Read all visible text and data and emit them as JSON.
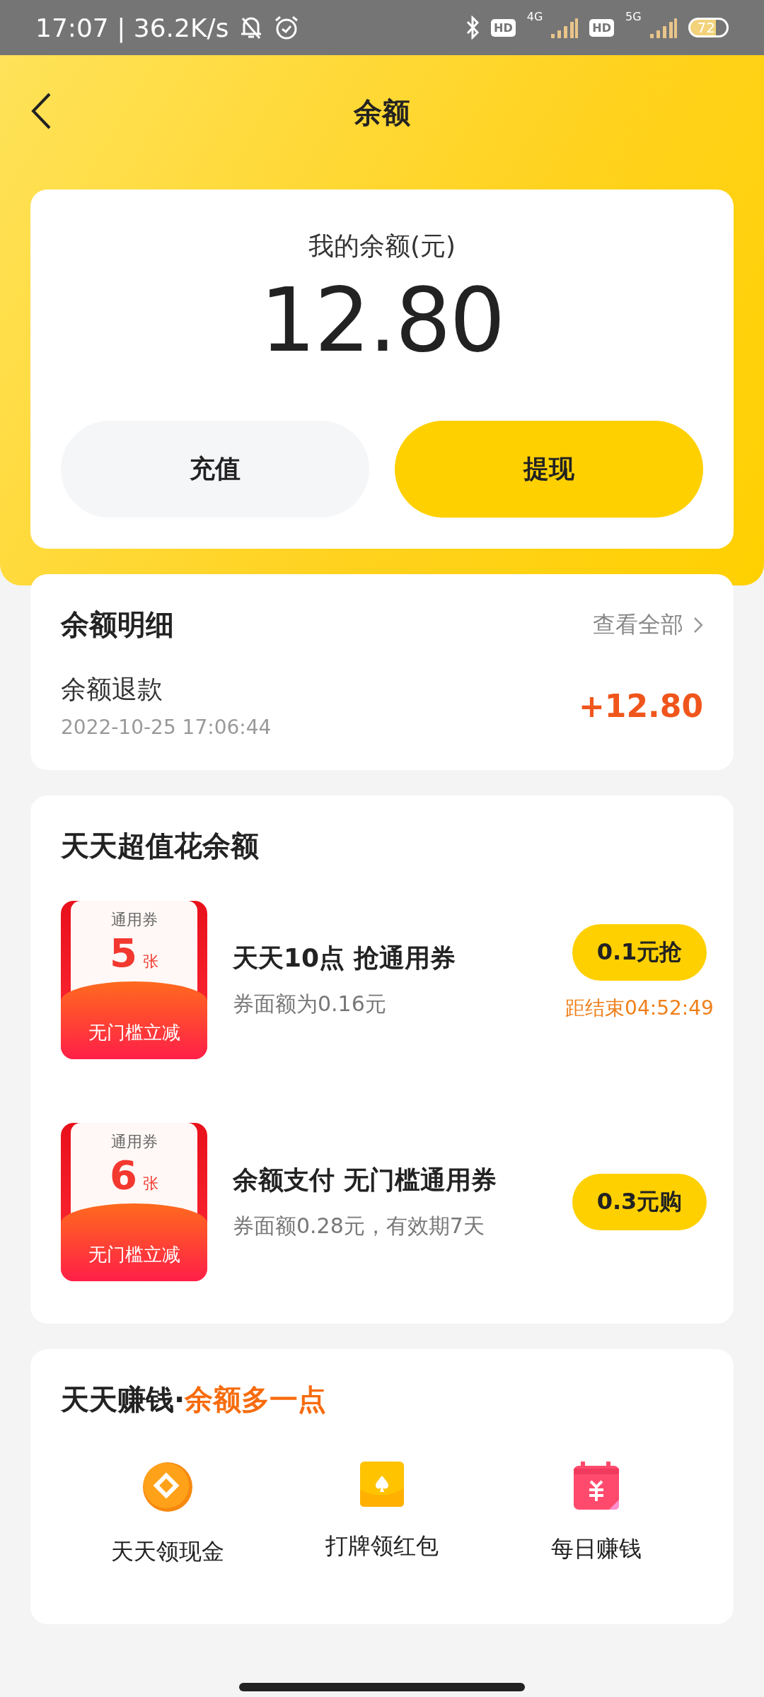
{
  "status_bar": {
    "time": "17:07 | 36.2K/s",
    "sim1_badge": "HD",
    "sim1_net": "4G",
    "sim2_badge": "HD",
    "sim2_net": "5G",
    "battery": "72"
  },
  "header": {
    "title": "余额"
  },
  "balance": {
    "label": "我的余额(元)",
    "amount": "12.80",
    "buttons": [
      {
        "label": "充值",
        "kind": "secondary"
      },
      {
        "label": "提现",
        "kind": "primary"
      }
    ]
  },
  "details": {
    "title": "余额明细",
    "link": "查看全部",
    "records": [
      {
        "name": "余额退款",
        "time": "2022-10-25 17:06:44",
        "amount": "+12.80"
      }
    ]
  },
  "deals": {
    "title": "天天超值花余额",
    "coupons": [
      {
        "ticket_label": "通用券",
        "count": "5",
        "unit": "张",
        "ticket_tag": "无门槛立减",
        "title": "天天10点 抢通用券",
        "subtitle": "券面额为0.16元",
        "button": "0.1元抢",
        "countdown": "距结束04:52:49"
      },
      {
        "ticket_label": "通用券",
        "count": "6",
        "unit": "张",
        "ticket_tag": "无门槛立减",
        "title": "余额支付 无门槛通用券",
        "subtitle": "券面额0.28元，有效期7天",
        "button": "0.3元购"
      }
    ]
  },
  "earn": {
    "title": "天天赚钱·",
    "highlight": "余额多一点",
    "entries": [
      {
        "kind": "coin",
        "label": "天天领现金"
      },
      {
        "kind": "cards",
        "label": "打牌领红包"
      },
      {
        "kind": "calendar",
        "label": "每日赚钱"
      }
    ]
  }
}
